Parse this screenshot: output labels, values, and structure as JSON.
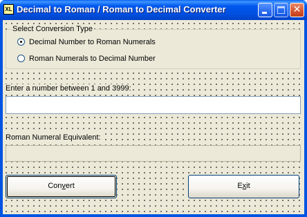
{
  "window": {
    "icon_text": "XL",
    "title": "Decimal to Roman / Roman to Decimal Converter"
  },
  "conversion_group": {
    "legend": "Select Conversion Type",
    "options": [
      {
        "label": "Decimal Number to Roman Numerals",
        "selected": true
      },
      {
        "label": "Roman Numerals to Decimal Number",
        "selected": false
      }
    ]
  },
  "input": {
    "label": "Enter a number between 1 and 3999:",
    "value": ""
  },
  "output": {
    "label": "Roman Numeral Equivalent:",
    "value": ""
  },
  "buttons": {
    "convert": {
      "pre": "Con",
      "accel": "v",
      "post": "ert"
    },
    "exit": {
      "pre": "E",
      "accel": "x",
      "post": "it"
    }
  }
}
